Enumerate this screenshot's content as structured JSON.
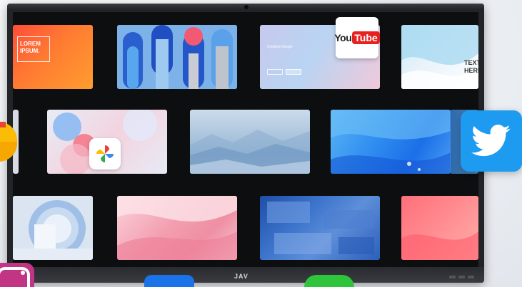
{
  "display": {
    "brand": "JAV"
  },
  "tiles": {
    "t1_text": "LOREM\nIPSUM.",
    "t3_text": "Creative Design",
    "t4_text": "TEXT\nHERE"
  },
  "apps": {
    "youtube": {
      "you": "You",
      "tube": "Tube"
    }
  },
  "colors": {
    "twitter": "#1d9bf0",
    "youtube_red": "#e5221f",
    "bezel": "#232428"
  }
}
